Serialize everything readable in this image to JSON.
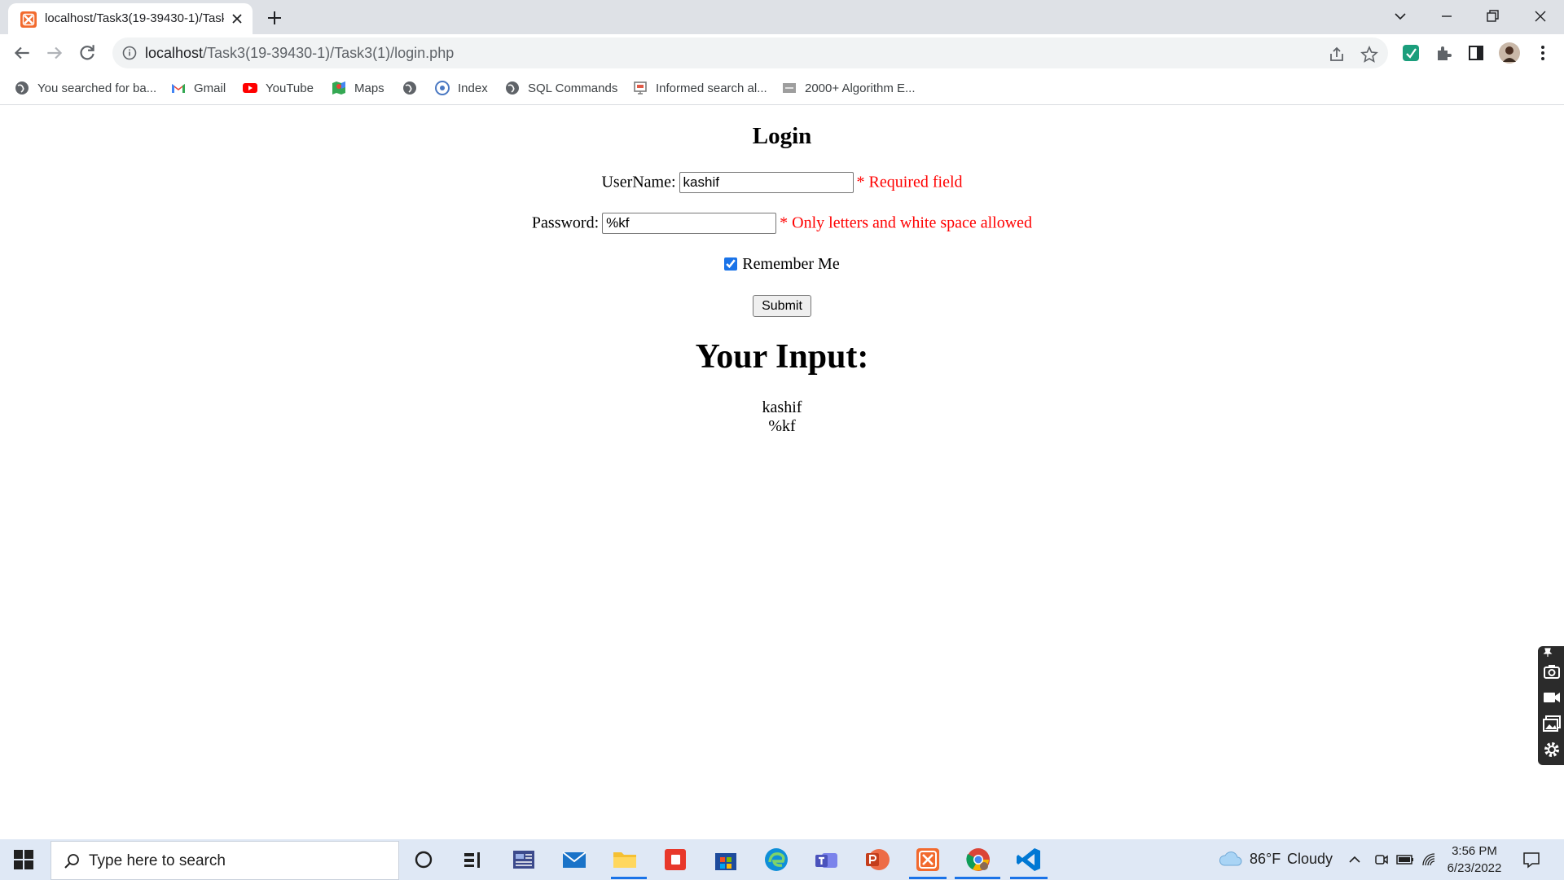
{
  "browser": {
    "tab_title": "localhost/Task3(19-39430-1)/Task3(1)/login.php",
    "url_host": "localhost",
    "url_path": "/Task3(19-39430-1)/Task3(1)/login.php"
  },
  "bookmarks": [
    {
      "label": "You searched for ba...",
      "icon": "globe-icon"
    },
    {
      "label": "Gmail",
      "icon": "gmail-icon"
    },
    {
      "label": "YouTube",
      "icon": "youtube-icon"
    },
    {
      "label": "Maps",
      "icon": "maps-icon"
    },
    {
      "label": "",
      "icon": "globe-icon"
    },
    {
      "label": "Index",
      "icon": "index-icon"
    },
    {
      "label": "SQL Commands",
      "icon": "globe-icon"
    },
    {
      "label": "Informed search al...",
      "icon": "slides-icon"
    },
    {
      "label": "2000+ Algorithm E...",
      "icon": "page-icon"
    }
  ],
  "form": {
    "title": "Login",
    "username_label": "UserName:",
    "username_value": "kashif",
    "username_error": "* Required field",
    "password_label": "Password:",
    "password_value": "%kf",
    "password_error": "* Only letters and white space allowed",
    "remember_label": "Remember Me",
    "remember_checked": true,
    "submit_label": "Submit"
  },
  "output": {
    "heading": "Your Input:",
    "lines": [
      "kashif",
      "%kf"
    ]
  },
  "taskbar": {
    "search_placeholder": "Type here to search",
    "weather_temp": "86°F",
    "weather_desc": "Cloudy",
    "time": "3:56 PM",
    "date": "6/23/2022"
  },
  "colors": {
    "error": "#ff0000",
    "accent": "#1a73e8"
  }
}
